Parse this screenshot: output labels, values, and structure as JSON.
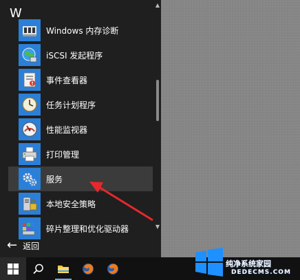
{
  "start_menu": {
    "section_letter": "W",
    "items": [
      {
        "label": "Windows 内存诊断",
        "icon": "memory-chip-icon"
      },
      {
        "label": "iSCSI 发起程序",
        "icon": "globe-network-icon"
      },
      {
        "label": "事件查看器",
        "icon": "event-viewer-icon"
      },
      {
        "label": "任务计划程序",
        "icon": "clock-icon"
      },
      {
        "label": "性能监视器",
        "icon": "gauge-icon"
      },
      {
        "label": "打印管理",
        "icon": "printer-icon"
      },
      {
        "label": "服务",
        "icon": "gears-icon"
      },
      {
        "label": "本地安全策略",
        "icon": "security-server-icon"
      },
      {
        "label": "碎片整理和优化驱动器",
        "icon": "defrag-icon"
      }
    ],
    "selected_label": "服务",
    "back_label": "返回"
  },
  "watermark": {
    "text": "纯净系统家园",
    "url": "DEDECMS.COM"
  },
  "colors": {
    "menu_bg": "#1f1f1f",
    "tile_blue": "#2b7fd7",
    "selected_bg": "#3b3b3b",
    "arrow_red": "#e8282b",
    "taskbar_bg": "#111111"
  }
}
